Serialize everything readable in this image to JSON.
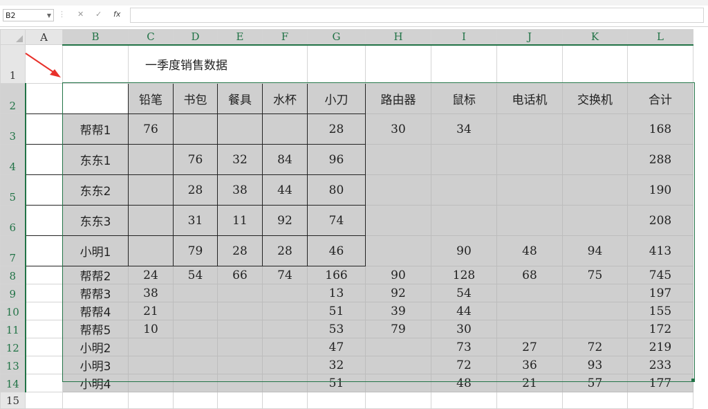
{
  "name_box": {
    "value": "B2"
  },
  "formula_bar": {
    "cancel": "✕",
    "enter": "✓",
    "fx": "fx",
    "value": ""
  },
  "columns": [
    "A",
    "B",
    "C",
    "D",
    "E",
    "F",
    "G",
    "H",
    "I",
    "J",
    "K",
    "L"
  ],
  "rows": [
    "1",
    "2",
    "3",
    "4",
    "5",
    "6",
    "7",
    "8",
    "9",
    "10",
    "11",
    "12",
    "13",
    "14",
    "15"
  ],
  "sheet": {
    "title": "一季度销售数据",
    "header": [
      "铅笔",
      "书包",
      "餐具",
      "水杯",
      "小刀",
      "路由器",
      "鼠标",
      "电话机",
      "交换机",
      "合计"
    ],
    "data": [
      [
        "帮帮1",
        "76",
        "",
        "",
        "",
        "28",
        "30",
        "34",
        "",
        "",
        "168"
      ],
      [
        "东东1",
        "",
        "76",
        "32",
        "84",
        "96",
        "",
        "",
        "",
        "",
        "288"
      ],
      [
        "东东2",
        "",
        "28",
        "38",
        "44",
        "80",
        "",
        "",
        "",
        "",
        "190"
      ],
      [
        "东东3",
        "",
        "31",
        "11",
        "92",
        "74",
        "",
        "",
        "",
        "",
        "208"
      ],
      [
        "小明1",
        "",
        "79",
        "28",
        "28",
        "46",
        "",
        "90",
        "48",
        "94",
        "413"
      ],
      [
        "帮帮2",
        "24",
        "54",
        "66",
        "74",
        "166",
        "90",
        "128",
        "68",
        "75",
        "745"
      ],
      [
        "帮帮3",
        "38",
        "",
        "",
        "",
        "13",
        "92",
        "54",
        "",
        "",
        "197"
      ],
      [
        "帮帮4",
        "21",
        "",
        "",
        "",
        "51",
        "39",
        "44",
        "",
        "",
        "155"
      ],
      [
        "帮帮5",
        "10",
        "",
        "",
        "",
        "53",
        "79",
        "30",
        "",
        "",
        "172"
      ],
      [
        "小明2",
        "",
        "",
        "",
        "",
        "47",
        "",
        "73",
        "27",
        "72",
        "219"
      ],
      [
        "小明3",
        "",
        "",
        "",
        "",
        "32",
        "",
        "72",
        "36",
        "93",
        "233"
      ],
      [
        "小明4",
        "",
        "",
        "",
        "",
        "51",
        "",
        "48",
        "21",
        "57",
        "177"
      ]
    ]
  },
  "colors": {
    "selection": "#217346",
    "selected_fill": "#cfcfcf",
    "arrow": "#e8302a"
  }
}
